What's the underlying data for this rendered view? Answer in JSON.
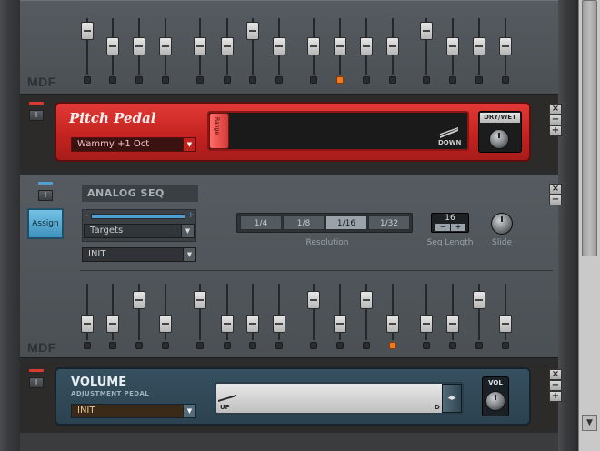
{
  "top_seq": {
    "device_label": "MDF",
    "sliders": [
      {
        "level": 0.9,
        "led": false
      },
      {
        "level": 0.5,
        "led": false
      },
      {
        "level": 0.5,
        "led": false
      },
      {
        "level": 0.5,
        "led": false
      },
      {
        "level": 0.5,
        "led": false
      },
      {
        "level": 0.5,
        "led": false
      },
      {
        "level": 0.9,
        "led": false
      },
      {
        "level": 0.5,
        "led": false
      },
      {
        "level": 0.5,
        "led": false
      },
      {
        "level": 0.5,
        "led": true
      },
      {
        "level": 0.5,
        "led": false
      },
      {
        "level": 0.5,
        "led": false
      },
      {
        "level": 0.9,
        "led": false
      },
      {
        "level": 0.5,
        "led": false
      },
      {
        "level": 0.5,
        "led": false
      },
      {
        "level": 0.5,
        "led": false
      }
    ]
  },
  "pitch_pedal": {
    "title": "Pitch Pedal",
    "preset": "Wammy +1 Oct",
    "handle_label": "Range",
    "down_label": "DOWN",
    "drywet_label": "DRY/WET",
    "power_icon": "power-icon"
  },
  "analog_seq": {
    "title": "ANALOG SEQ",
    "assign_label": "Assign",
    "macro_minus": "-",
    "macro_plus": "+",
    "targets_label": "Targets",
    "patch": "INIT",
    "resolution_options": [
      "1/4",
      "1/8",
      "1/16",
      "1/32"
    ],
    "resolution_selected": "1/16",
    "resolution_label": "Resolution",
    "seq_length_value": "16",
    "seq_length_minus": "−",
    "seq_length_plus": "+",
    "seq_length_label": "Seq Length",
    "slide_label": "Slide",
    "device_label": "MDF",
    "sliders": [
      {
        "level": 0.2,
        "led": false
      },
      {
        "level": 0.2,
        "led": false
      },
      {
        "level": 0.8,
        "led": false
      },
      {
        "level": 0.2,
        "led": false
      },
      {
        "level": 0.8,
        "led": false
      },
      {
        "level": 0.2,
        "led": false
      },
      {
        "level": 0.2,
        "led": false
      },
      {
        "level": 0.2,
        "led": false
      },
      {
        "level": 0.8,
        "led": false
      },
      {
        "level": 0.2,
        "led": false
      },
      {
        "level": 0.8,
        "led": false
      },
      {
        "level": 0.2,
        "led": true
      },
      {
        "level": 0.2,
        "led": false
      },
      {
        "level": 0.2,
        "led": false
      },
      {
        "level": 0.8,
        "led": false
      },
      {
        "level": 0.2,
        "led": false
      }
    ]
  },
  "volume": {
    "title": "VOLUME",
    "subtitle": "ADJUSTMENT PEDAL",
    "preset": "INIT",
    "up_label": "UP",
    "d_label": "D",
    "vol_label": "VOL",
    "handle_glyph": "◂▸"
  },
  "controls": {
    "close": "×",
    "minus": "−",
    "plus": "+",
    "power": "I",
    "dropdown_arrow": "▼"
  },
  "colors": {
    "pedal_red": "#c1221f",
    "assign_blue": "#4f9fd0",
    "led_orange": "#f07a1d",
    "volume_blue": "#2c4250"
  }
}
